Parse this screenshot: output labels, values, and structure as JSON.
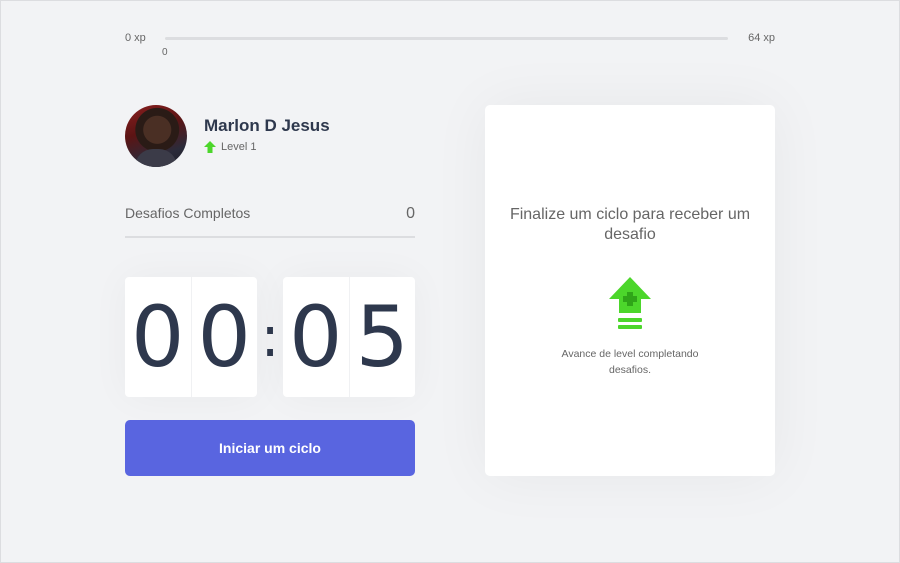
{
  "experience": {
    "min_label": "0 xp",
    "max_label": "64 xp",
    "current_label": "0",
    "progress_fraction": 0
  },
  "profile": {
    "name": "Marlon D Jesus",
    "level_label": "Level 1",
    "avatar_icon": "user-photo",
    "level_icon": "up-arrow-icon"
  },
  "completed_challenges": {
    "label": "Desafios Completos",
    "value": "0"
  },
  "countdown": {
    "minute_left": "0",
    "minute_right": "0",
    "separator": ":",
    "second_left": "0",
    "second_right": "5"
  },
  "start_button": {
    "label": "Iniciar um ciclo"
  },
  "challenge_box": {
    "title": "Finalize um ciclo para receber um desafio",
    "icon": "level-up-icon",
    "description": "Avance de level completando desafios."
  },
  "colors": {
    "background": "#f2f3f5",
    "primary": "#5965e0",
    "green": "#4cd62b",
    "title": "#2e384d",
    "text": "#666666"
  }
}
